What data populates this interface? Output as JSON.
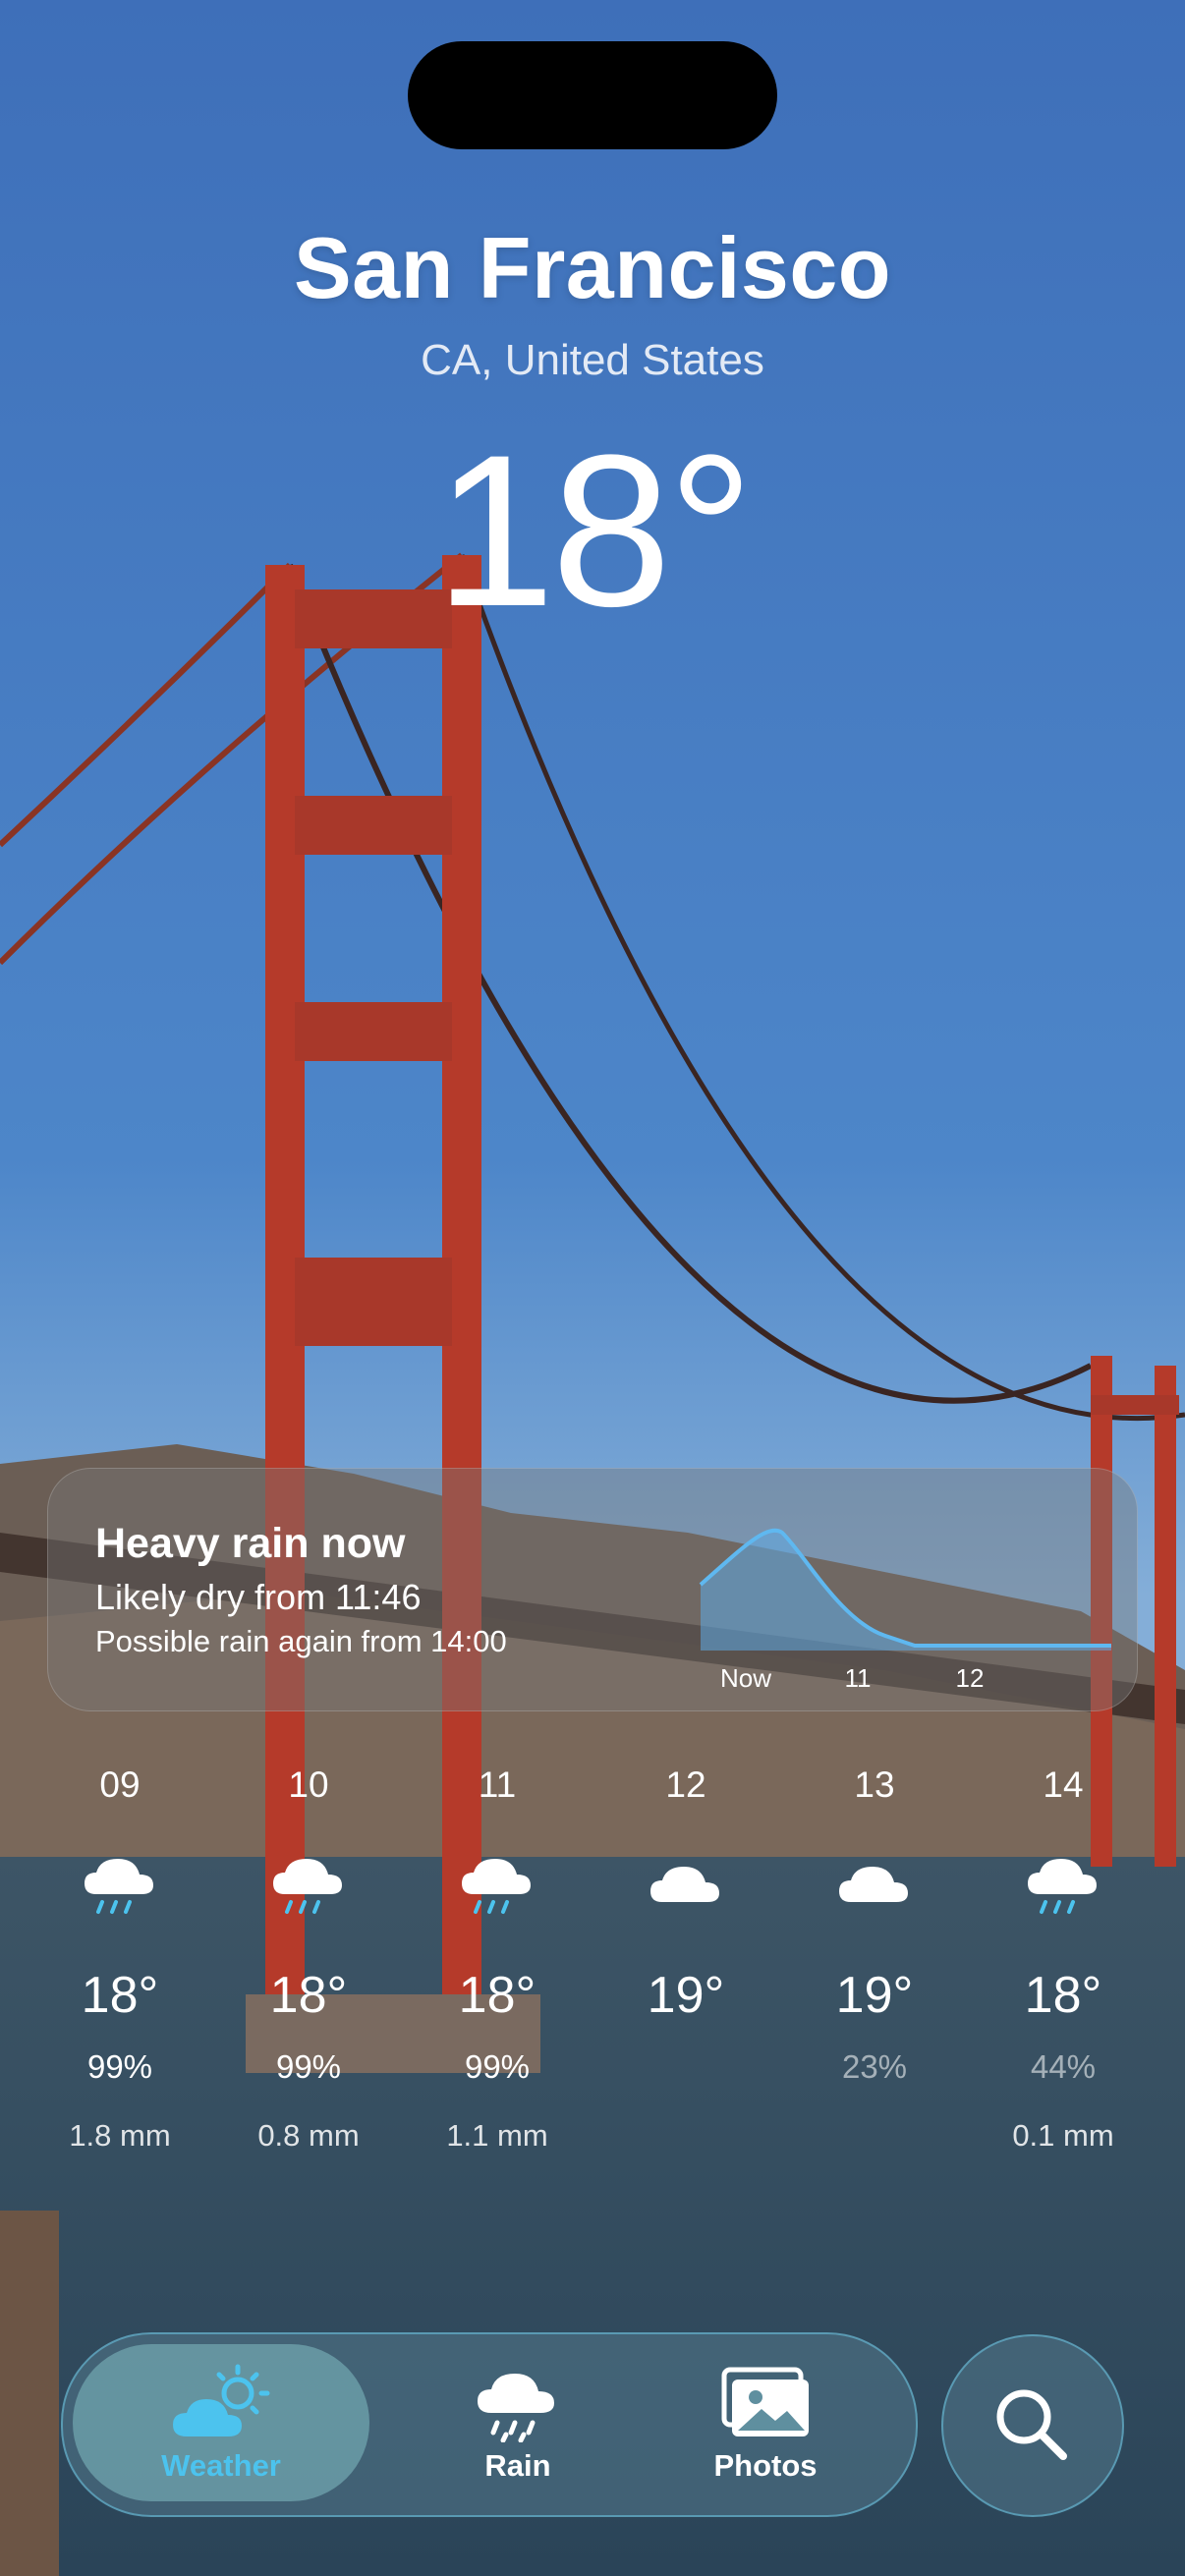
{
  "location": {
    "city": "San Francisco",
    "region": "CA, United States"
  },
  "current": {
    "temperature": "18°"
  },
  "rain_card": {
    "title": "Heavy rain now",
    "line1": "Likely dry from 11:46",
    "line2": "Possible rain again from 14:00",
    "axis_labels": [
      "Now",
      "11",
      "12"
    ]
  },
  "hourly": [
    {
      "time": "09",
      "icon": "rain-cloud-icon",
      "temp": "18°",
      "precip_chance": "99%",
      "precip_amount": "1.8 mm",
      "dim": false
    },
    {
      "time": "10",
      "icon": "rain-cloud-icon",
      "temp": "18°",
      "precip_chance": "99%",
      "precip_amount": "0.8 mm",
      "dim": false
    },
    {
      "time": "11",
      "icon": "rain-cloud-icon",
      "temp": "18°",
      "precip_chance": "99%",
      "precip_amount": "1.1 mm",
      "dim": false
    },
    {
      "time": "12",
      "icon": "cloud-icon",
      "temp": "19°",
      "precip_chance": "",
      "precip_amount": "",
      "dim": false
    },
    {
      "time": "13",
      "icon": "cloud-icon",
      "temp": "19°",
      "precip_chance": "23%",
      "precip_amount": "",
      "dim": true
    },
    {
      "time": "14",
      "icon": "rain-cloud-icon",
      "temp": "18°",
      "precip_chance": "44%",
      "precip_amount": "0.1 mm",
      "dim": true
    }
  ],
  "nav": {
    "tabs": [
      {
        "label": "Weather",
        "icon": "sun-cloud-icon",
        "active": true
      },
      {
        "label": "Rain",
        "icon": "rain-cloud-icon",
        "active": false
      },
      {
        "label": "Photos",
        "icon": "photos-icon",
        "active": false
      }
    ],
    "search_icon": "search-icon"
  },
  "colors": {
    "accent": "#4cc3ee",
    "tower": "#b53a2a",
    "sky": "#3b6fb6"
  }
}
